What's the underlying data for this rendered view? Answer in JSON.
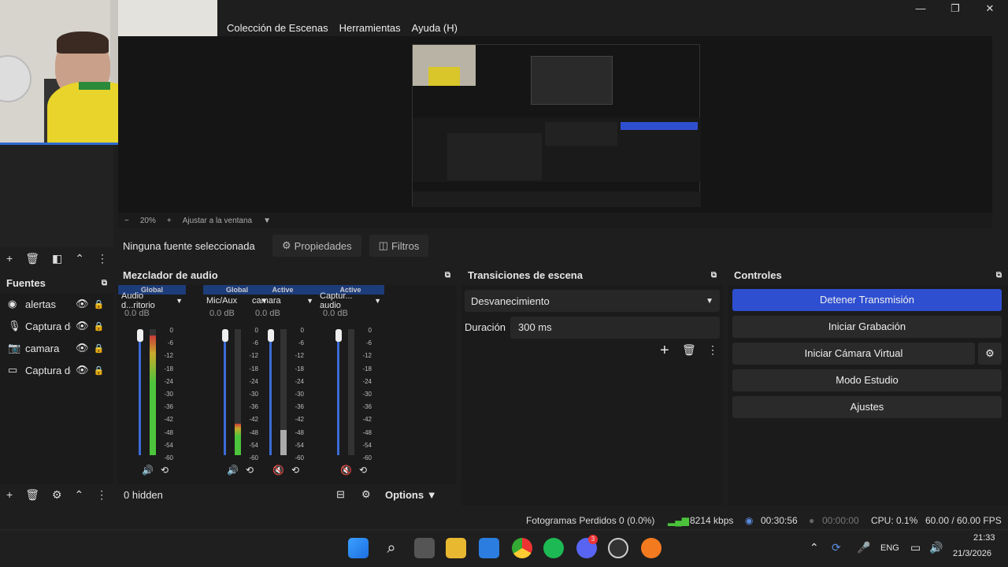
{
  "window": {
    "min": "—",
    "max": "❐",
    "close": "✕"
  },
  "menu": [
    "Colección de Escenas",
    "Herramientas",
    "Ayuda (H)"
  ],
  "zoom": {
    "minus": "−",
    "value": "20%",
    "plus": "+",
    "fit": "Ajustar a la ventana"
  },
  "source_bar": {
    "none_selected": "Ninguna fuente seleccionada",
    "properties": "Propiedades",
    "filters": "Filtros"
  },
  "sources": {
    "title": "Fuentes",
    "items": [
      {
        "name": "alertas",
        "icon": "globe-icon"
      },
      {
        "name": "Captura de audio",
        "icon": "mic-icon"
      },
      {
        "name": "camara",
        "icon": "camera-icon"
      },
      {
        "name": "Captura de pantalla",
        "icon": "monitor-icon"
      }
    ]
  },
  "mixer": {
    "title": "Mezclador de audio",
    "hidden": "0 hidden",
    "options": "Options",
    "ticks": [
      "0",
      "-6",
      "-12",
      "-18",
      "-24",
      "-30",
      "-36",
      "-42",
      "-48",
      "-54",
      "-60"
    ],
    "channels": [
      {
        "badge": "Global",
        "name": "Audio d...ritorio",
        "db": "0.0 dB",
        "muted": false,
        "level": 0.95
      },
      {
        "badge": "Global",
        "name": "Mic/Aux",
        "db": "0.0 dB",
        "muted": false,
        "level": 0.25
      },
      {
        "badge": "Active",
        "name": "camara",
        "db": "0.0 dB",
        "muted": true,
        "level": 0.2
      },
      {
        "badge": "Active",
        "name": "Captur... audio",
        "db": "0.0 dB",
        "muted": true,
        "level": 0.0
      }
    ]
  },
  "transitions": {
    "title": "Transiciones de escena",
    "selected": "Desvanecimiento",
    "duration_label": "Duración",
    "duration_value": "300 ms"
  },
  "controls": {
    "title": "Controles",
    "stop_stream": "Detener Transmisión",
    "start_recording": "Iniciar Grabación",
    "start_vcam": "Iniciar Cámara Virtual",
    "studio_mode": "Modo Estudio",
    "settings": "Ajustes"
  },
  "status": {
    "dropped": "Fotogramas Perdidos 0 (0.0%)",
    "bitrate": "8214 kbps",
    "stream_time": "00:30:56",
    "rec_time": "00:00:00",
    "cpu": "CPU: 0.1%",
    "fps": "60.00 / 60.00 FPS"
  },
  "taskbar": {
    "lang": "ENG",
    "time": "21:33",
    "date": "21/3/2026",
    "badge": "3"
  },
  "colors": {
    "accent": "#2f4fd1",
    "meter_green": "#4cc43c",
    "meter_yellow": "#c8a92b",
    "meter_red": "#c83a3a"
  }
}
